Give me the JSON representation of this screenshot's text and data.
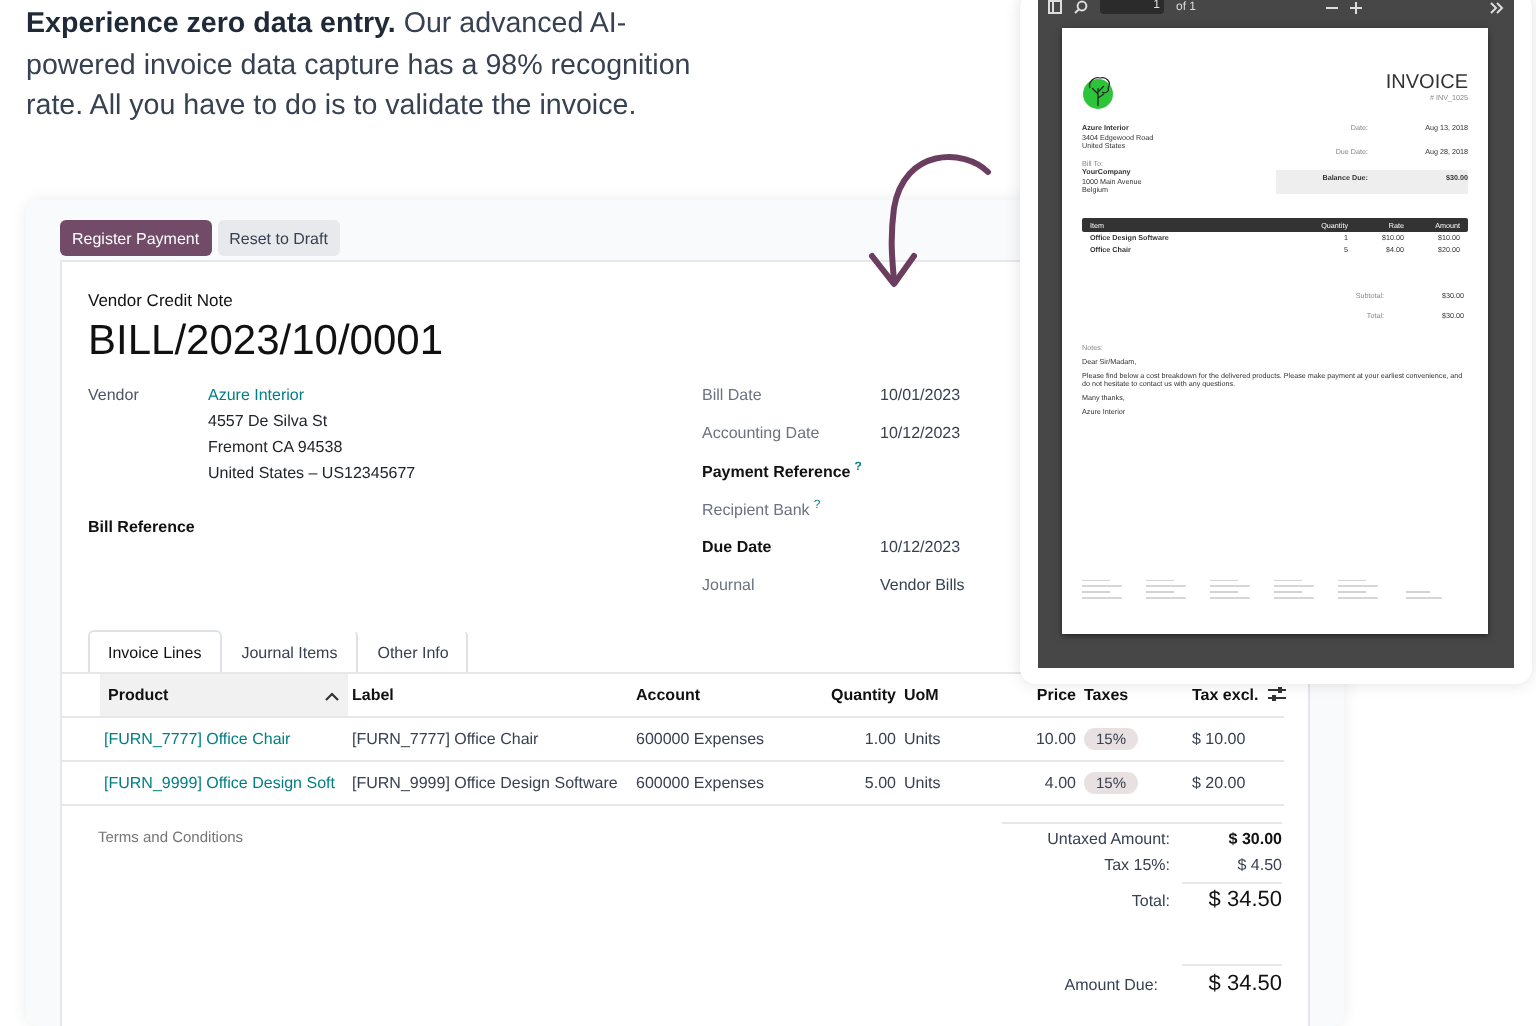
{
  "headline": {
    "text": "**Experience zero data entry.** Our advanced AI-powered invoice data capture has a 98% recognition rate. All you have to do is to validate the invoice."
  },
  "form": {
    "buttons": [
      {
        "label": "Register Payment",
        "primary": true
      },
      {
        "label": "Reset to Draft",
        "primary": false
      }
    ],
    "doc_type": "Vendor Credit Note",
    "title": "BILL/2023/10/0001",
    "vendor": {
      "label": "Vendor",
      "name": "Azure Interior",
      "address": [
        "4557 De Silva St",
        "Fremont CA 94538",
        "United States – US12345677"
      ]
    },
    "bill_reference": {
      "label": "Bill Reference"
    },
    "fields": [
      {
        "label": "Bill Date",
        "value": "10/01/2023",
        "required": false
      },
      {
        "label": "Accounting Date",
        "value": "10/12/2023",
        "required": false
      },
      {
        "label": "Payment Reference",
        "help": "?",
        "required": true
      },
      {
        "label": "Recipient Bank",
        "help": "?",
        "required": false
      },
      {
        "label": "Due Date",
        "value": "10/12/2023",
        "required": true
      },
      {
        "label": "Journal",
        "value": "Vendor Bills",
        "required": false
      }
    ],
    "tabs": [
      {
        "label": "Invoice Lines",
        "selected": true
      },
      {
        "label": "Journal Items",
        "selected": false
      },
      {
        "label": "Other Info",
        "selected": false
      }
    ],
    "table": {
      "columns": [
        {
          "label": "Product",
          "numeric": false,
          "sorted": true
        },
        {
          "label": "Label",
          "numeric": false,
          "sorted": false
        },
        {
          "label": "Account",
          "numeric": false,
          "sorted": false
        },
        {
          "label": "Quantity",
          "numeric": true,
          "sorted": false
        },
        {
          "label": "UoM",
          "numeric": false,
          "sorted": false
        },
        {
          "label": "Price",
          "numeric": true,
          "sorted": false
        },
        {
          "label": "Taxes",
          "numeric": false,
          "sorted": false
        },
        {
          "label": "Tax excl.",
          "numeric": false,
          "sorted": false
        }
      ],
      "rows": [
        {
          "product": "[FURN_7777] Office Chair",
          "label": "[FURN_7777] Office Chair",
          "account": "600000 Expenses",
          "quantity": "1.00",
          "uom": "Units",
          "price": "10.00",
          "tax": "15%",
          "subtotal": "$ 10.00"
        },
        {
          "product": "[FURN_9999] Office Design Soft",
          "label": "[FURN_9999] Office Design Software",
          "account": "600000 Expenses",
          "quantity": "5.00",
          "uom": "Units",
          "price": "4.00",
          "tax": "15%",
          "subtotal": "$ 20.00"
        }
      ]
    },
    "terms_placeholder": "Terms and Conditions",
    "totals": [
      {
        "label": "Untaxed Amount:",
        "value": "$ 30.00",
        "kind": "subtotal"
      },
      {
        "label": "Tax 15%:",
        "value": "$ 4.50",
        "kind": "tax"
      },
      {
        "label": "Total:",
        "value": "$ 34.50",
        "kind": "total"
      }
    ],
    "amount_due": {
      "label": "Amount Due:",
      "value": "$ 34.50"
    }
  },
  "pdf_viewer": {
    "page_input": "1",
    "page_count": "of 1",
    "document": {
      "title": "INVOICE",
      "number": "# INV_1025",
      "from": [
        "Azure Interior",
        "3404 Edgewood Road",
        "United States"
      ],
      "bill_to_label": "Bill To:",
      "bill_to": [
        "YourCompany",
        "1000 Main Avenue",
        "Belgium"
      ],
      "meta": [
        {
          "label": "Date:",
          "value": "Aug 13, 2018"
        },
        {
          "label": "Due Date:",
          "value": "Aug 28, 2018"
        }
      ],
      "balance": {
        "label": "Balance Due:",
        "value": "$30.00"
      },
      "columns": [
        "Item",
        "Quantity",
        "Rate",
        "Amount"
      ],
      "items": [
        [
          "Office Design Software",
          "1",
          "$10.00",
          "$10.00"
        ],
        [
          "Office Chair",
          "5",
          "$4.00",
          "$20.00"
        ]
      ],
      "summary": [
        {
          "label": "Subtotal:",
          "value": "$30.00"
        },
        {
          "label": "Total:",
          "value": "$30.00"
        }
      ],
      "notes_label": "Notes:",
      "notes": [
        "Dear Sir/Madam,",
        "Please find below a cost breakdown for the delivered products. Please make payment at your earliest convenience, and do not hesitate to contact us with any questions.",
        "Many thanks,",
        "Azure Interior"
      ]
    }
  }
}
